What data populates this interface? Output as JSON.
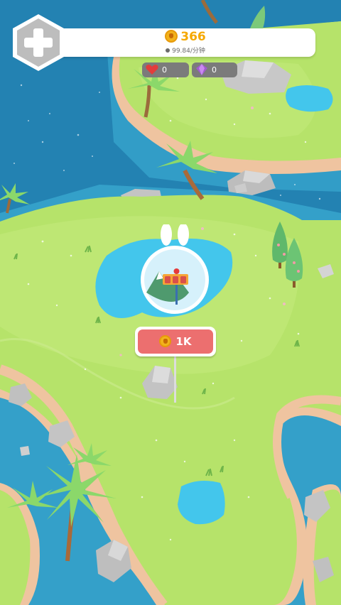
{
  "hud": {
    "add_button_icon": "plus-icon",
    "coins": "366",
    "rate": "99.84/分钟",
    "hearts": "0",
    "gems": "0"
  },
  "world": {
    "build_cost": "1K",
    "build_marker_icon": "bunny-dome-icon"
  },
  "colors": {
    "sea": "#1f7fb0",
    "grass": "#b6e36a",
    "sand": "#efc4a0",
    "cost_button": "#ec6f6f",
    "coin": "#f2b21b"
  }
}
